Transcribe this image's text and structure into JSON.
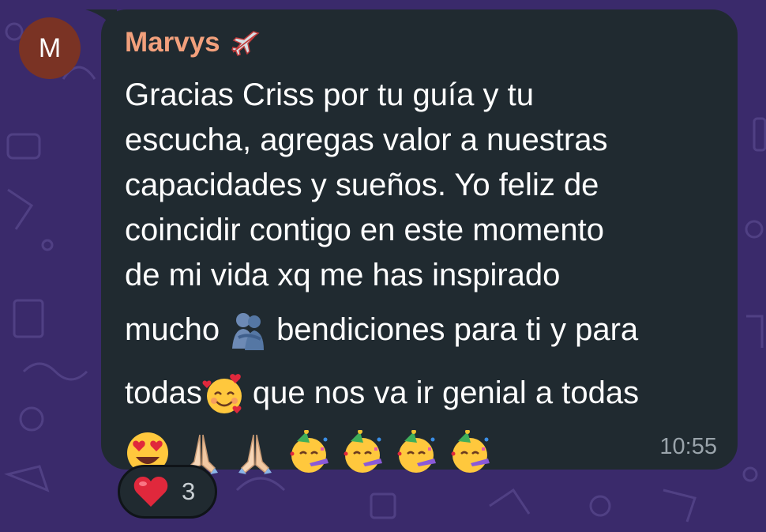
{
  "avatar": {
    "initial": "M",
    "color": "#7a3324"
  },
  "message": {
    "sender": "Marvys",
    "sender_emoji": "airplane-icon",
    "sender_color": "#f2a07c",
    "lines": [
      "Gracias Criss por tu guía y tu",
      "escucha, agregas valor a nuestras",
      "capacidades y sueños. Yo feliz de",
      "coincidir contigo en este momento",
      "de mi vida xq me has inspirado"
    ],
    "line6_before": "mucho",
    "line6_after": "bendiciones para ti y para",
    "line7_before": "todas",
    "line7_after": "que nos va ir genial a todas",
    "time": "10:55"
  },
  "reaction": {
    "emoji": "heart-icon",
    "count": "3"
  },
  "colors": {
    "wallpaper": "#3a2a6b",
    "bubble": "#202a30",
    "timestamp": "#9aa4ab"
  }
}
